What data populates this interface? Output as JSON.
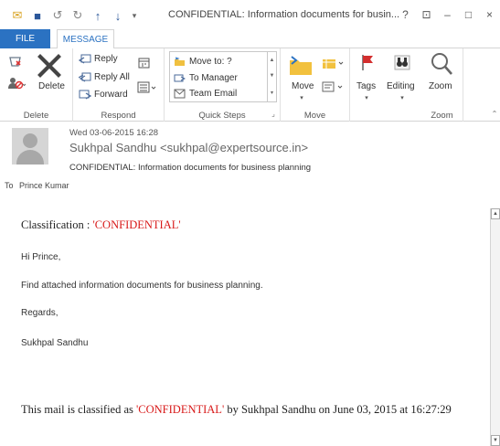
{
  "window": {
    "title": "CONFIDENTIAL: Information documents for busin...",
    "help": "?",
    "restore_ribbon": "⊡",
    "minimize": "–",
    "maximize": "□",
    "close": "×"
  },
  "qat": {
    "mail": "✉",
    "save": "■",
    "undo": "↺",
    "redo": "↻",
    "up": "↑",
    "down": "↓",
    "customize": "▾"
  },
  "tabs": {
    "file": "FILE",
    "message": "MESSAGE"
  },
  "ribbon": {
    "delete_group": {
      "label": "Delete",
      "delete_button": "Delete"
    },
    "respond_group": {
      "label": "Respond",
      "reply": "Reply",
      "reply_all": "Reply All",
      "forward": "Forward"
    },
    "quick_steps_group": {
      "label": "Quick Steps",
      "items": [
        "Move to: ?",
        "To Manager",
        "Team Email"
      ]
    },
    "move_group": {
      "label": "Move",
      "move_button": "Move"
    },
    "tags_button": "Tags",
    "editing_button": "Editing",
    "zoom_group": {
      "label": "Zoom",
      "zoom_button": "Zoom"
    }
  },
  "header": {
    "date": "Wed 03-06-2015 16:28",
    "from": "Sukhpal Sandhu <sukhpal@expertsource.in>",
    "subject": "CONFIDENTIAL: Information documents for business planning",
    "to_label": "To",
    "to": "Prince Kumar"
  },
  "body": {
    "classification_label": "Classification : ",
    "classification_value": "'CONFIDENTIAL'",
    "greeting": "Hi Prince,",
    "line1": "Find attached information documents for business planning.",
    "regards": "Regards,",
    "signature": "Sukhpal Sandhu",
    "footer_pre": "This mail is classified as ",
    "footer_value": "'CONFIDENTIAL'",
    "footer_post": " by Sukhpal Sandhu on June 03, 2015 at 16:27:29"
  },
  "colors": {
    "accent": "#2b72c2",
    "confidential_red": "#d81919"
  }
}
